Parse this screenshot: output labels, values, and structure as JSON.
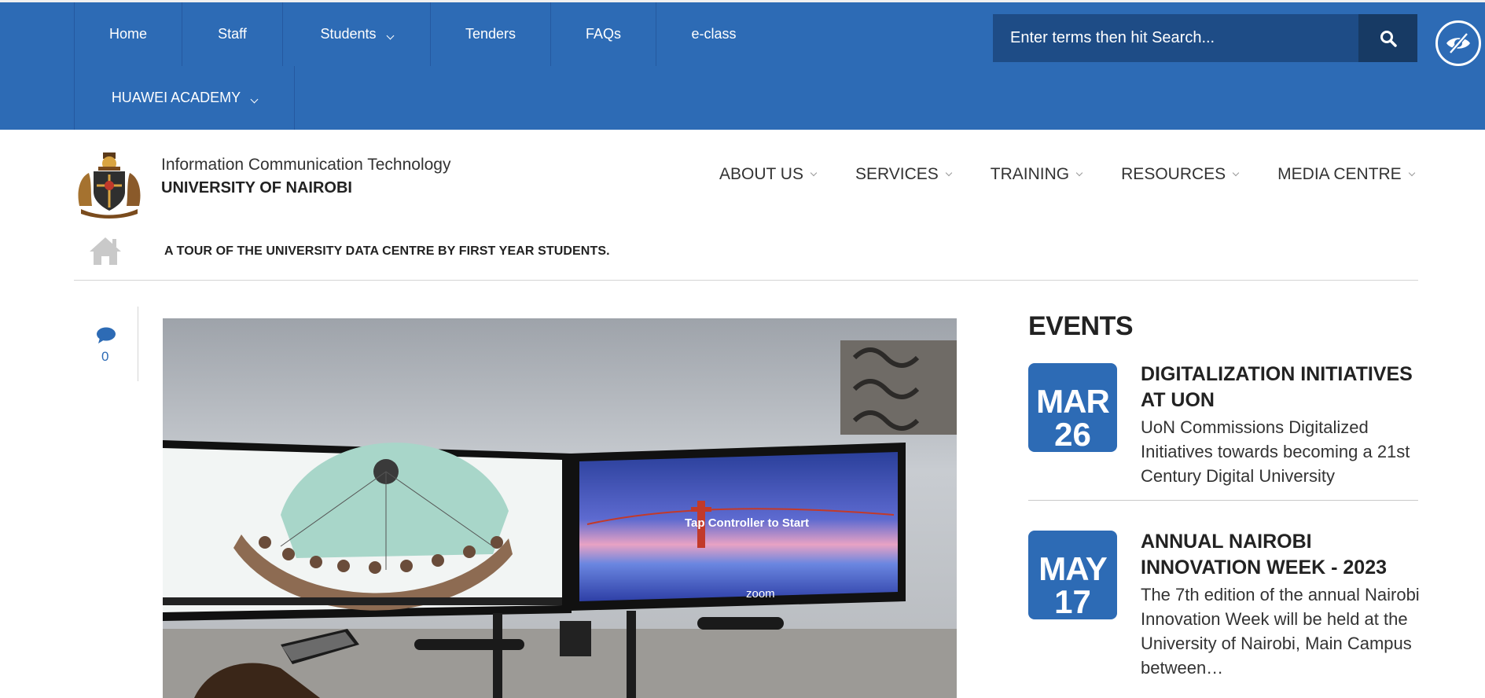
{
  "topnav": {
    "row1": [
      {
        "label": "Home",
        "has_dropdown": false
      },
      {
        "label": "Staff",
        "has_dropdown": false
      },
      {
        "label": "Students",
        "has_dropdown": true
      },
      {
        "label": "Tenders",
        "has_dropdown": false
      },
      {
        "label": "FAQs",
        "has_dropdown": false
      },
      {
        "label": "e-class",
        "has_dropdown": false
      }
    ],
    "row2": [
      {
        "label": "HUAWEI ACADEMY",
        "has_dropdown": true
      }
    ]
  },
  "search": {
    "placeholder": "Enter terms then hit Search...",
    "button_icon": "search-icon"
  },
  "accessibility_button_icon": "eye-slash-icon",
  "brand": {
    "line1": "Information Communication Technology",
    "line2": "UNIVERSITY OF NAIROBI",
    "logo_icon": "coat-of-arms-logo"
  },
  "main_nav": [
    {
      "label": "ABOUT US"
    },
    {
      "label": "SERVICES"
    },
    {
      "label": "TRAINING"
    },
    {
      "label": "RESOURCES"
    },
    {
      "label": "MEDIA CENTRE"
    }
  ],
  "breadcrumb": {
    "home_icon": "home-icon",
    "title": "A TOUR OF THE UNIVERSITY DATA CENTRE BY FIRST YEAR STUDENTS."
  },
  "comments": {
    "icon": "comment-icon",
    "count": "0"
  },
  "photo": {
    "screen_text": "Tap Controller to Start",
    "brand_text": "zoom"
  },
  "events": {
    "heading": "EVENTS",
    "items": [
      {
        "month": "MAR",
        "day": "26",
        "title": "DIGITALIZATION INITIATIVES AT UON",
        "description": "UoN Commissions Digitalized Initiatives towards becoming a 21st Century Digital University"
      },
      {
        "month": "MAY",
        "day": "17",
        "title": "ANNUAL NAIROBI INNOVATION WEEK - 2023",
        "description": "The 7th edition of the annual Nairobi Innovation Week will be held at the University of Nairobi, Main Campus between…"
      }
    ]
  },
  "colors": {
    "primary_blue": "#2d6bb5",
    "search_bg": "#1e4c86",
    "search_button_bg": "#173a64"
  }
}
